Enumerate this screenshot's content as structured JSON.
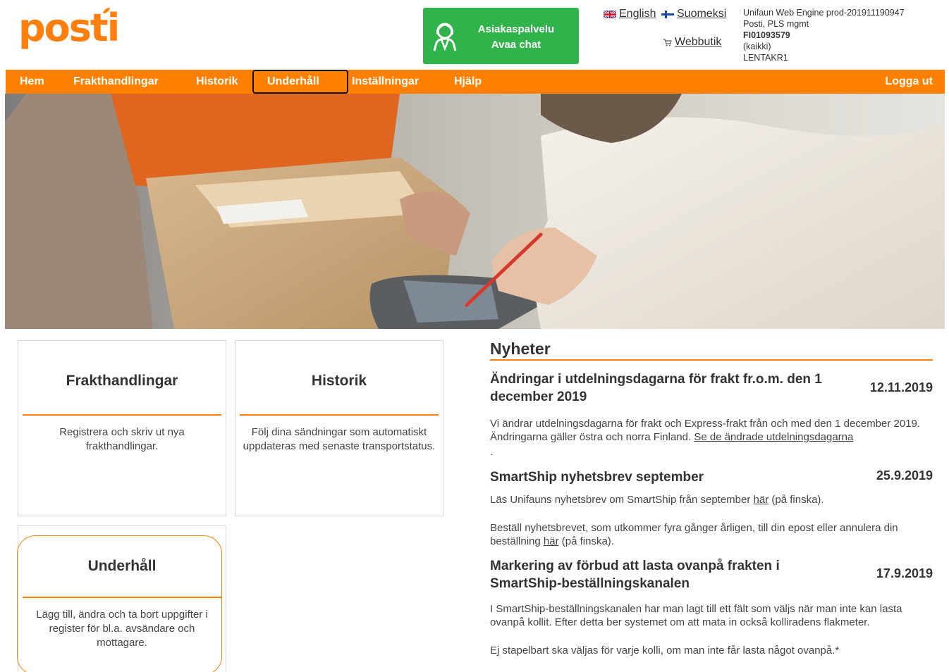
{
  "brand": {
    "logo_text": "posti",
    "accent": "#ff8000",
    "chat_green": "#30b34a"
  },
  "header": {
    "chat": {
      "line1": "Asiakaspalvelu",
      "line2": "Avaa chat",
      "icon": "support-agent-icon"
    },
    "languages": {
      "english": "English",
      "suomeksi": "Suomeksi",
      "webbutik": "Webbutik"
    },
    "engine": {
      "line1": "Unifaun Web Engine prod-201911190947",
      "line2": "Posti, PLS mgmt",
      "line3": "FI01093579",
      "line4": "(kaikki)",
      "line5": "LENTAKR1"
    }
  },
  "nav": {
    "items": [
      "Hem",
      "Frakthandlingar",
      "Historik",
      "Underhåll",
      "Inställningar",
      "Hjälp"
    ],
    "active": "Underhåll",
    "logout": "Logga ut"
  },
  "tiles": [
    {
      "title": "Frakthandlingar",
      "desc": "Registrera och skriv ut nya frakthandlingar."
    },
    {
      "title": "Historik",
      "desc": "Följ dina sändningar som automatiskt uppdateras med senaste transportstatus."
    },
    {
      "title": "Underhåll",
      "desc": "Lägg till, ändra och ta bort uppgifter i register för bl.a. avsändare och mottagare."
    }
  ],
  "news": {
    "heading": "Nyheter",
    "items": [
      {
        "title": "Ändringar i utdelningsdagarna för frakt fr.o.m. den 1 december 2019",
        "date": "12.11.2019",
        "body1": "Vi ändrar utdelningsdagarna för frakt och Express-frakt från och med den 1 december 2019. Ändringarna gäller östra och norra Finland.",
        "link": "Se de ändrade utdelningsdagarna",
        "trailing": "."
      },
      {
        "title": "SmartShip nyhetsbrev september",
        "date": "25.9.2019",
        "p1_before": "Läs Unifauns nyhetsbrev om SmartShip från september",
        "p1_link": "här",
        "p1_after": "(på finska).",
        "p2_before": "Beställ nyhetsbrevet, som utkommer fyra gånger årligen, till din epost eller annulera din beställning",
        "p2_link": "här",
        "p2_after": "(på finska)."
      },
      {
        "title": "Markering av förbud att lasta ovanpå frakten i SmartShip-beställningskanalen",
        "date": "17.9.2019",
        "p1": "I SmartShip-beställningskanalen har man lagt till ett fält som väljs när man inte kan lasta ovanpå kollit. Efter detta ber systemet om att mata in också kolliradens flakmeter.",
        "p2": "Ej stapelbart ska väljas för varje kolli, om man inte får lasta något ovanpå.*"
      }
    ]
  }
}
